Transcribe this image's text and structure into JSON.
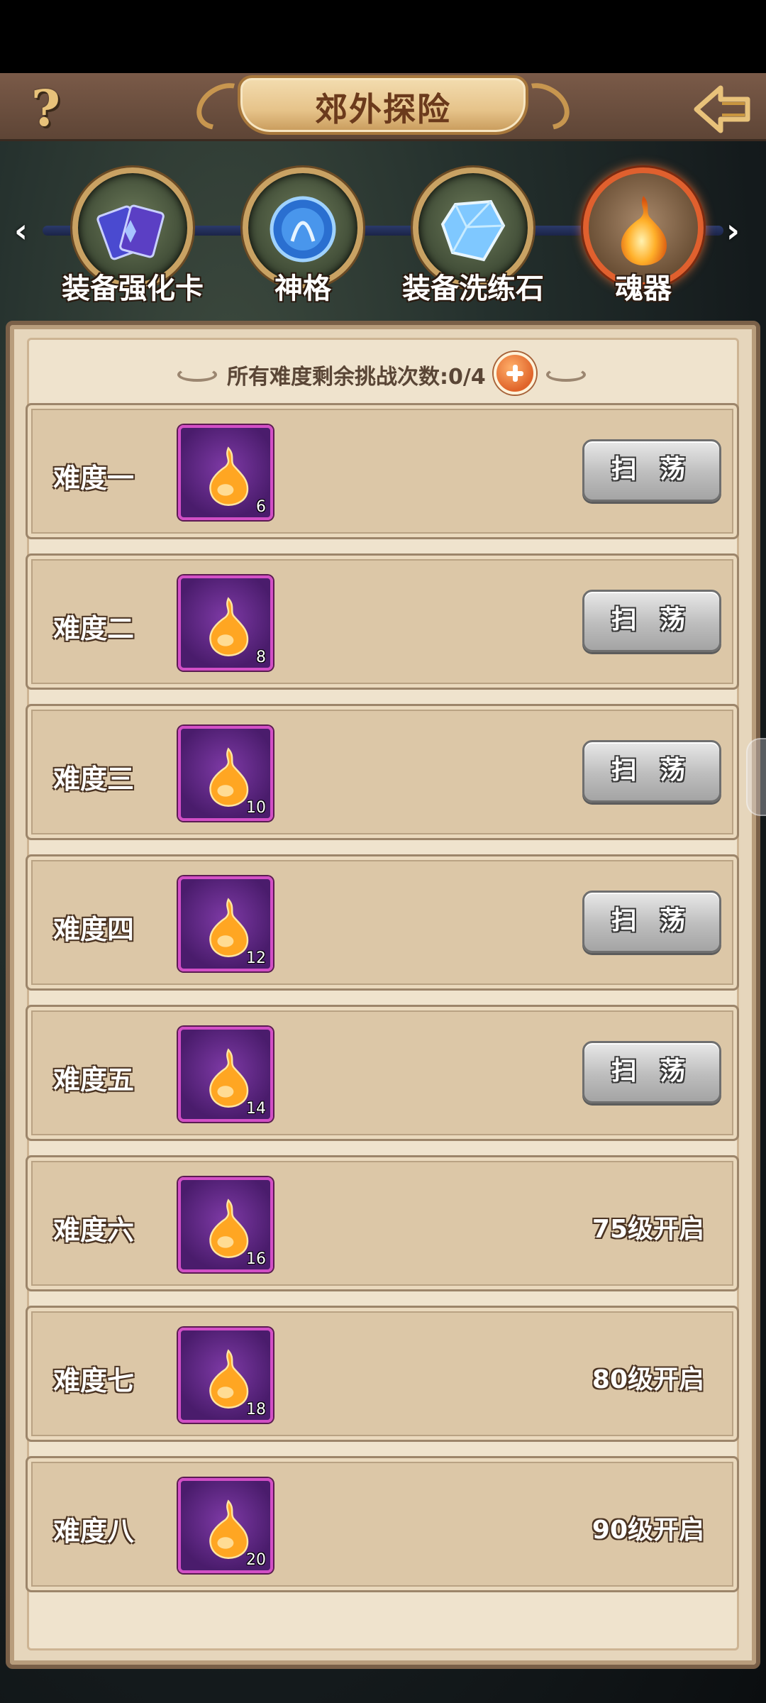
{
  "header": {
    "title": "郊外探险",
    "help_label": "?"
  },
  "categories": [
    {
      "label": "装备强化卡",
      "icon": "cards-icon",
      "active": false
    },
    {
      "label": "神格",
      "icon": "orb-icon",
      "active": false
    },
    {
      "label": "装备洗练石",
      "icon": "crystal-icon",
      "active": false
    },
    {
      "label": "魂器",
      "icon": "soul-flame-icon",
      "active": true
    }
  ],
  "attempts": {
    "text": "所有难度剩余挑战次数:0/4"
  },
  "difficulties": [
    {
      "name": "难度一",
      "reward_count": "6",
      "action": "扫 荡",
      "unlock": ""
    },
    {
      "name": "难度二",
      "reward_count": "8",
      "action": "扫 荡",
      "unlock": ""
    },
    {
      "name": "难度三",
      "reward_count": "10",
      "action": "扫 荡",
      "unlock": ""
    },
    {
      "name": "难度四",
      "reward_count": "12",
      "action": "扫 荡",
      "unlock": ""
    },
    {
      "name": "难度五",
      "reward_count": "14",
      "action": "扫 荡",
      "unlock": ""
    },
    {
      "name": "难度六",
      "reward_count": "16",
      "action": "",
      "unlock": "75级开启"
    },
    {
      "name": "难度七",
      "reward_count": "18",
      "action": "",
      "unlock": "80级开启"
    },
    {
      "name": "难度八",
      "reward_count": "20",
      "action": "",
      "unlock": "90级开启"
    }
  ],
  "colors": {
    "header_bg": "#5e4536",
    "panel_bg": "#efe3cd",
    "row_bg": "#dcc7a7",
    "item_border": "#d24fc6",
    "plus_button": "#e0642a",
    "active_ring": "#e0602e"
  }
}
